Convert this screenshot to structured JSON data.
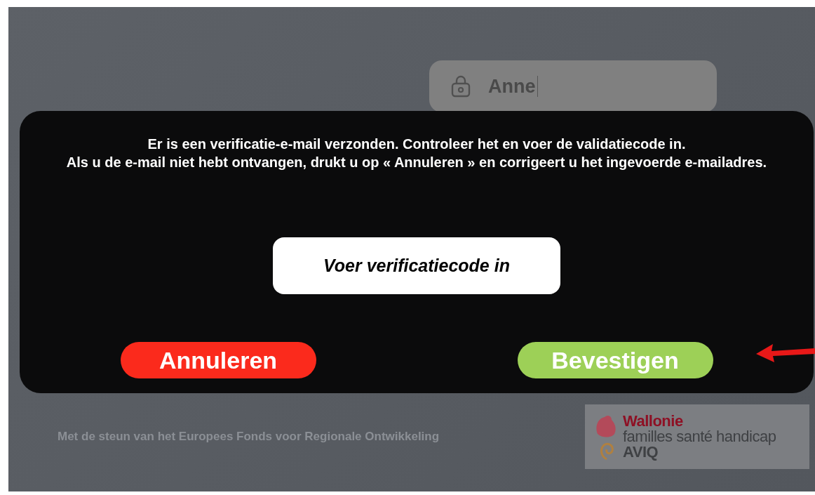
{
  "background_form": {
    "name_field": {
      "value": "Anne"
    }
  },
  "dialog": {
    "message": [
      "Er is een verificatie-e-mail verzonden. Controleer het en voer de validatiecode in.",
      "Als u de e-mail niet hebt ontvangen, drukt u op « Annuleren » en corrigeert u het ingevoerde e-mailadres."
    ],
    "code_field": {
      "placeholder": "Voer verificatiecode in"
    },
    "buttons": [
      {
        "kind": "cancel",
        "label": "Annuleren"
      },
      {
        "kind": "confirm",
        "label": "Bevestigen"
      }
    ]
  },
  "footer": {
    "text": "Met de steun van het Europees Fonds voor Regionale Ontwikkeling",
    "logo_lines": [
      "Wallonie",
      "familles santé handicap",
      "AVIQ"
    ]
  }
}
